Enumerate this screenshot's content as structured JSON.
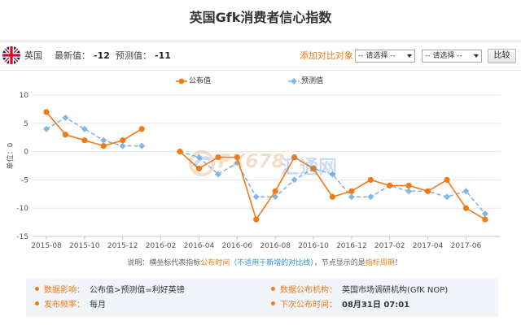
{
  "toolbar": {
    "flag_icon": "uk-flag-icon",
    "country": "英国",
    "latest_label": "最新值：",
    "latest_value": "-12",
    "forecast_label": "预测值：",
    "forecast_value": "-11",
    "compare_label": "添加对比对象：",
    "select1": "-- 请选择 --",
    "select2": "-- 请选择 --",
    "compare_button": "比较"
  },
  "watermark": {
    "logo_icon": "fx678-logo-icon",
    "latin": "FX678",
    "cn": "汇通网"
  },
  "note": {
    "prefix": "说明：横坐标代表指标",
    "highlight1": "公布时间",
    "paren": "（不适用于新增的对比线）",
    "middle": "，节点显示的是",
    "highlight2": "指标周期",
    "suffix": "！"
  },
  "info": {
    "impact_label": "数据影响：",
    "impact_value": "公布值>预测值=利好英镑",
    "frequency_label": "发布频率：",
    "frequency_value": "每月",
    "agency_label": "数据公布机构：",
    "agency_value": "英国市场调研机构(GfK NOP)",
    "next_label": "下次公布时间：",
    "next_value": "08月31日 07:01"
  },
  "colors": {
    "accent": "#f07b14",
    "link": "#2f8fdd"
  },
  "chart_data": {
    "type": "line",
    "title": "英国Gfk消费者信心指数",
    "ylabel": "单位：0",
    "x": [
      "2015-08",
      "2015-09",
      "2015-10",
      "2015-11",
      "2015-12",
      "2016-01",
      "2016-02",
      "2016-03",
      "2016-04",
      "2016-05",
      "2016-06",
      "2016-07",
      "2016-08",
      "2016-09",
      "2016-10",
      "2016-11",
      "2016-12",
      "2017-01",
      "2017-02",
      "2017-03",
      "2017-04",
      "2017-05",
      "2017-06",
      "2017-07"
    ],
    "x_tick_labels": [
      "2015-08",
      "2015-10",
      "2015-12",
      "2016-02",
      "2016-04",
      "2016-06",
      "2016-08",
      "2016-10",
      "2016-12",
      "2017-02",
      "2017-04",
      "2017-06"
    ],
    "ylim": [
      -15,
      10
    ],
    "y_ticks": [
      10,
      5,
      0,
      -5,
      -10,
      -15
    ],
    "grid": true,
    "legend": "top-center",
    "series": [
      {
        "name": "公布值",
        "color": "#f07b14",
        "style": "solid",
        "marker": "circle",
        "values": [
          7,
          3,
          2,
          1,
          2,
          4,
          null,
          0,
          -3,
          -1,
          -1,
          -12,
          -7,
          -1,
          -3,
          -8,
          -7,
          -5,
          -6,
          -6,
          -7,
          -5,
          -10,
          -12
        ]
      },
      {
        "name": "预测值",
        "color": "#84b6e6",
        "style": "dashed",
        "marker": "diamond",
        "values": [
          4,
          6,
          4,
          2,
          1,
          1,
          null,
          0,
          -1,
          -4,
          -2,
          -8,
          -8,
          -5,
          -3,
          -4,
          -8,
          -8,
          -6,
          -7,
          -7,
          -8,
          -7,
          -11
        ]
      }
    ]
  }
}
